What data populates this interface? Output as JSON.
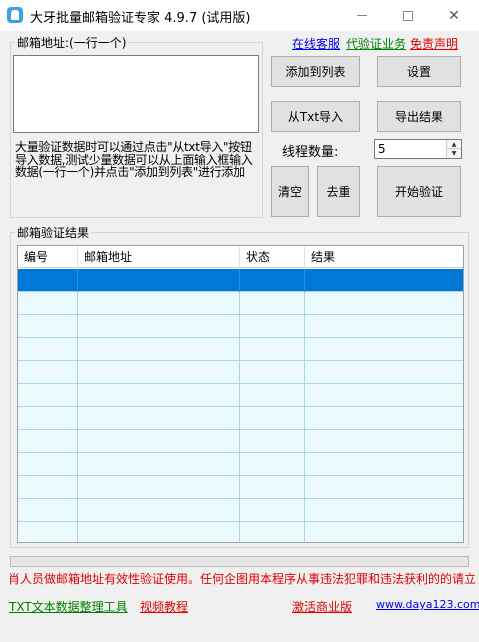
{
  "window": {
    "title": "大牙批量邮箱验证专家 4.9.7  (试用版)",
    "minimize": "minimize",
    "maximize": "maximize",
    "close": "✕"
  },
  "email_group": {
    "label": "邮箱地址:(一行一个)",
    "input_value": "",
    "tip": "大量验证数据时可以通过点击\"从txt导入\"按钮导入数据,测试少量数据可以从上面输入框输入数据(一行一个)并点击\"添加到列表\"进行添加"
  },
  "links": {
    "support": "在线客服",
    "service": "代验证业务",
    "disclaimer": "免责声明"
  },
  "buttons": {
    "add": "添加到列表",
    "settings": "设置",
    "import": "从Txt导入",
    "export": "导出结果",
    "clear": "清空",
    "dedupe": "去重",
    "start": "开始验证"
  },
  "threads": {
    "label": "线程数量:",
    "value": "5"
  },
  "result_group": {
    "label": "邮箱验证结果",
    "columns": [
      "编号",
      "邮箱地址",
      "状态",
      "结果"
    ],
    "row_count": 12,
    "selected_row": 0
  },
  "progress": {
    "fraction": 0
  },
  "marquee": "肖人员做邮箱地址有效性验证使用。任何企图用本程序从事违法犯罪和违法获利的的请立",
  "footer": {
    "txt_tool": "TXT文本数据整理工具",
    "video": "视频教程",
    "activate": "激活商业版",
    "site": "www.daya123.com"
  },
  "colors": {
    "accent": "#0078d7",
    "row": "#ebfbfd",
    "link_blue": "#0000ee",
    "link_green": "#008000",
    "link_red": "#e00000"
  }
}
